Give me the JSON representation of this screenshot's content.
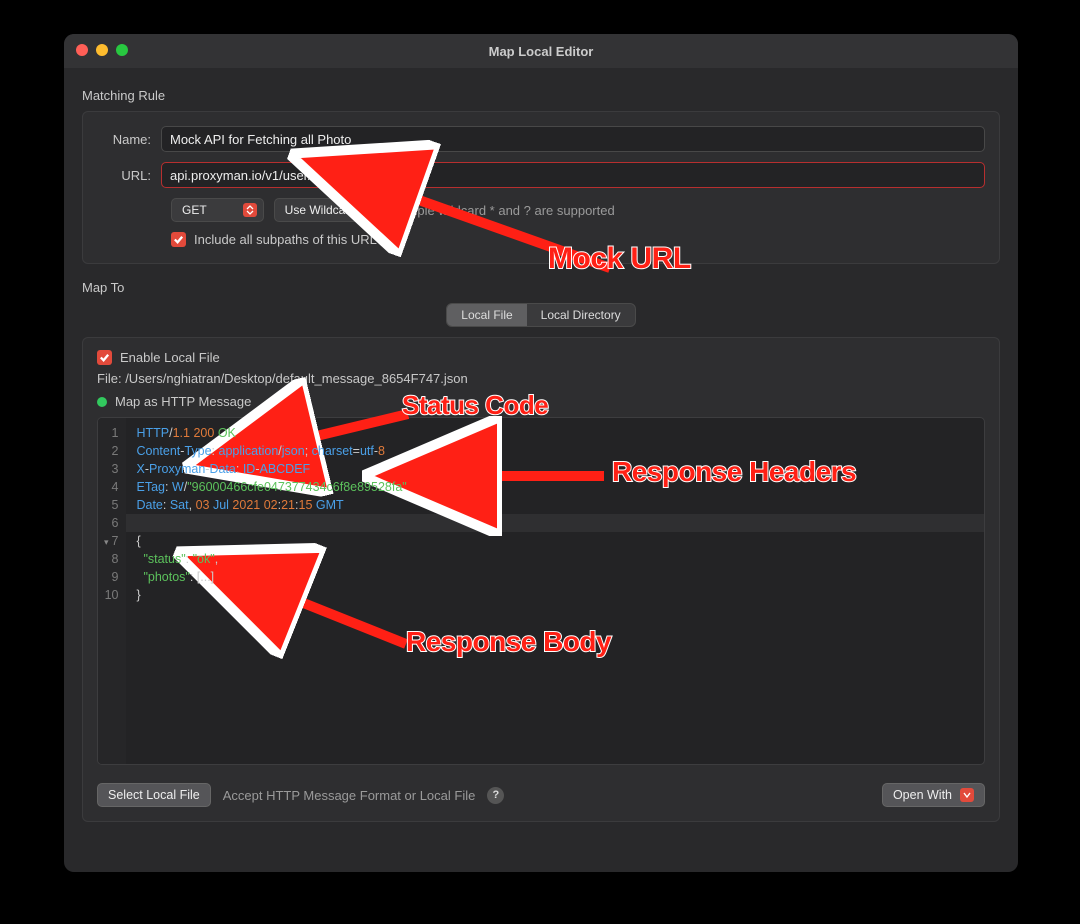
{
  "window": {
    "title": "Map Local Editor"
  },
  "matching_rule": {
    "section_label": "Matching Rule",
    "name_label": "Name:",
    "name_value": "Mock API for Fetching all Photo",
    "url_label": "URL:",
    "url_value": "api.proxyman.io/v1/user/photos",
    "method": "GET",
    "wildcard_mode": "Use Wildcard",
    "wildcard_hint": "Simple wildcard * and ? are supported",
    "include_subpaths_label": "Include all subpaths of this URL",
    "include_subpaths_checked": true
  },
  "map_to": {
    "section_label": "Map To",
    "tabs": [
      "Local File",
      "Local Directory"
    ],
    "active_tab": 0,
    "enable_local_file_label": "Enable Local File",
    "enable_local_file_checked": true,
    "file_label": "File:",
    "file_path": "/Users/nghiatran/Desktop/default_message_8654F747.json",
    "status_label": "Map as HTTP Message"
  },
  "editor": {
    "lines": [
      {
        "n": 1,
        "tokens": [
          [
            "kw",
            "HTTP"
          ],
          [
            "punc",
            "/"
          ],
          [
            "num",
            "1.1"
          ],
          [
            "plain",
            " "
          ],
          [
            "num",
            "200"
          ],
          [
            "plain",
            " "
          ],
          [
            "ok",
            "OK"
          ]
        ]
      },
      {
        "n": 2,
        "tokens": [
          [
            "kw",
            "Content"
          ],
          [
            "punc",
            "-"
          ],
          [
            "kw",
            "Type"
          ],
          [
            "punc",
            ": "
          ],
          [
            "kw",
            "application"
          ],
          [
            "punc",
            "/"
          ],
          [
            "kw",
            "json"
          ],
          [
            "punc",
            "; "
          ],
          [
            "kw",
            "charset"
          ],
          [
            "punc",
            "="
          ],
          [
            "kw",
            "utf"
          ],
          [
            "punc",
            "-"
          ],
          [
            "num",
            "8"
          ]
        ]
      },
      {
        "n": 3,
        "tokens": [
          [
            "kw",
            "X"
          ],
          [
            "punc",
            "-"
          ],
          [
            "kw",
            "Proxyman"
          ],
          [
            "punc",
            "-"
          ],
          [
            "kw",
            "Data"
          ],
          [
            "punc",
            ": "
          ],
          [
            "kw",
            "ID"
          ],
          [
            "punc",
            "-"
          ],
          [
            "kw",
            "ABCDEF"
          ]
        ]
      },
      {
        "n": 4,
        "tokens": [
          [
            "kw",
            "ETag"
          ],
          [
            "punc",
            ": "
          ],
          [
            "kw",
            "W"
          ],
          [
            "punc",
            "/"
          ],
          [
            "str",
            "\"96000466cfe047377434c6f8e89528fa\""
          ]
        ]
      },
      {
        "n": 5,
        "tokens": [
          [
            "kw",
            "Date"
          ],
          [
            "punc",
            ": "
          ],
          [
            "kw",
            "Sat"
          ],
          [
            "punc",
            ", "
          ],
          [
            "num",
            "03"
          ],
          [
            "plain",
            " "
          ],
          [
            "kw",
            "Jul"
          ],
          [
            "plain",
            " "
          ],
          [
            "num",
            "2021"
          ],
          [
            "plain",
            " "
          ],
          [
            "num",
            "02"
          ],
          [
            "punc",
            ":"
          ],
          [
            "num",
            "21"
          ],
          [
            "punc",
            ":"
          ],
          [
            "num",
            "15"
          ],
          [
            "plain",
            " "
          ],
          [
            "kw",
            "GMT"
          ]
        ]
      },
      {
        "n": 6,
        "tokens": [
          [
            "plain",
            ""
          ]
        ]
      },
      {
        "n": 7,
        "fold": true,
        "tokens": [
          [
            "punc",
            "{"
          ]
        ]
      },
      {
        "n": 8,
        "tokens": [
          [
            "plain",
            "  "
          ],
          [
            "str",
            "\"status\""
          ],
          [
            "punc",
            ": "
          ],
          [
            "str",
            "\"ok\""
          ],
          [
            "punc",
            ","
          ]
        ]
      },
      {
        "n": 9,
        "tokens": [
          [
            "plain",
            "  "
          ],
          [
            "str",
            "\"photos\""
          ],
          [
            "punc",
            ": [...]"
          ]
        ]
      },
      {
        "n": 10,
        "tokens": [
          [
            "punc",
            "}"
          ]
        ]
      }
    ]
  },
  "bottom": {
    "select_file_label": "Select Local File",
    "hint": "Accept HTTP Message Format or Local File",
    "open_with_label": "Open With"
  },
  "annotations": {
    "mock_url": "Mock URL",
    "status_code": "Status Code",
    "response_headers": "Response Headers",
    "response_body": "Response Body"
  }
}
